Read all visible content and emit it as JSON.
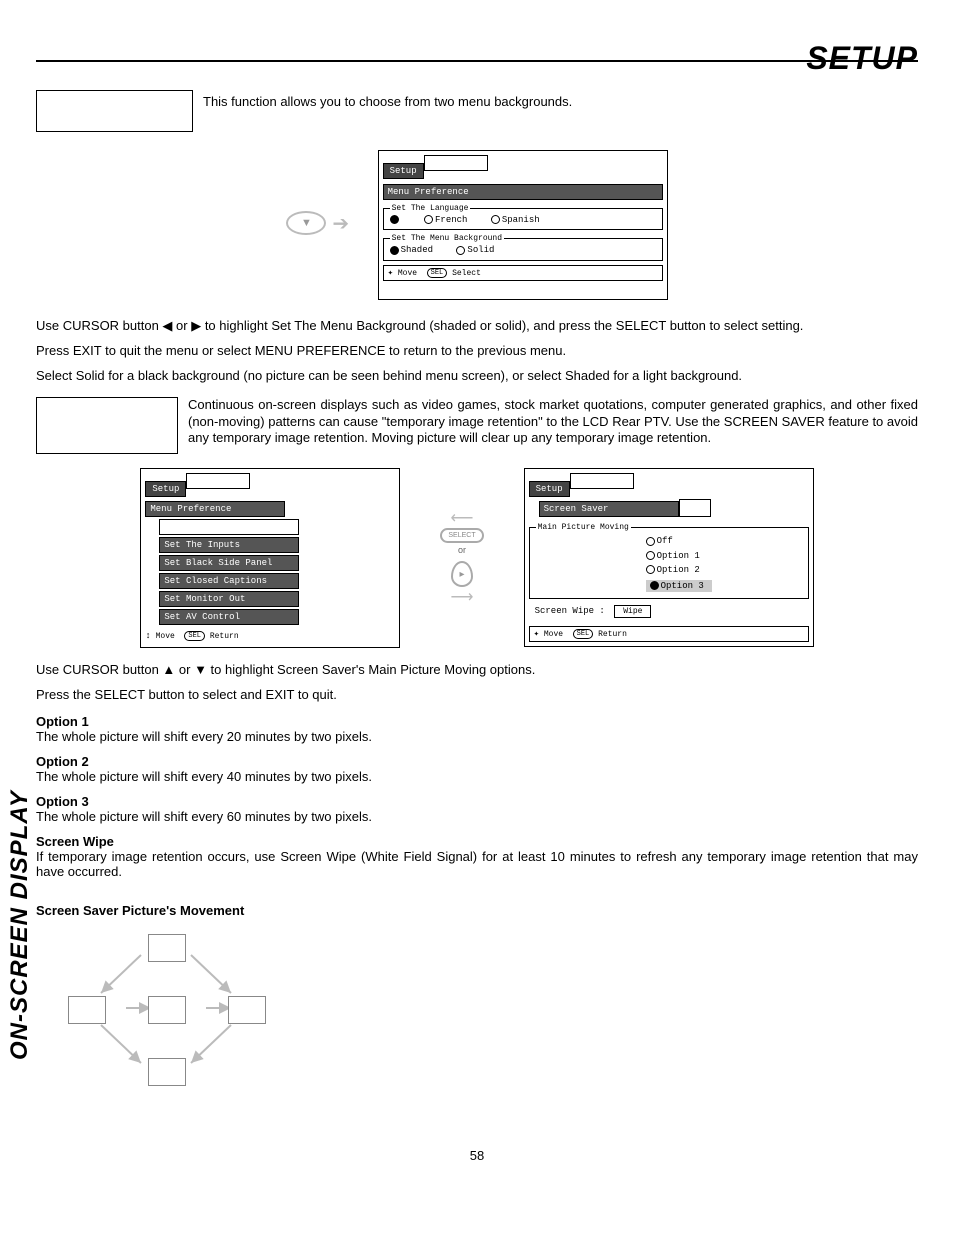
{
  "header": {
    "title": "SETUP"
  },
  "sideLabel": "ON-SCREEN DISPLAY",
  "section1": {
    "intro": "This function allows you to choose from two menu backgrounds.",
    "osd1": {
      "tab": "Setup",
      "subtitle": "Menu Preference",
      "langLegend": "Set The Language",
      "langOpts": {
        "french": "French",
        "spanish": "Spanish"
      },
      "bgLegend": "Set The Menu Background",
      "bgOpts": {
        "shaded": "Shaded",
        "solid": "Solid"
      },
      "hintMove": "Move",
      "hintSel": "SEL",
      "hintSelect": "Select"
    },
    "para1": "Use CURSOR button ◀ or ▶ to highlight Set The Menu Background (shaded or solid), and press the SELECT button to select setting.",
    "para2": "Press EXIT to quit the menu or select MENU PREFERENCE to return to the previous menu.",
    "para3": "Select Solid for a black background (no picture can be seen behind menu screen), or select Shaded for a light background."
  },
  "section2": {
    "intro": "Continuous on-screen displays such as video games, stock market quotations, computer generated graphics, and other fixed (non-moving) patterns can cause \"temporary image retention\" to the LCD Rear PTV.  Use the SCREEN SAVER feature to avoid any temporary image retention.  Moving picture will clear up any temporary image retention.",
    "osdLeft": {
      "tab": "Setup",
      "items": [
        "Menu Preference",
        "Set The Inputs",
        "Set Black Side Panel",
        "Set Closed Captions",
        "Set Monitor Out",
        "Set AV Control"
      ],
      "hintMove": "Move",
      "hintSel": "SEL",
      "hintReturn": "Return"
    },
    "mid": {
      "select": "SELECT",
      "or": "or"
    },
    "osdRight": {
      "tab": "Setup",
      "sub": "Screen Saver",
      "legend": "Main Picture Moving",
      "opts": {
        "off": "Off",
        "o1": "Option 1",
        "o2": "Option 2",
        "o3": "Option 3"
      },
      "wipeLabel": "Screen Wipe :",
      "wipeBtn": "Wipe",
      "hintMove": "Move",
      "hintSel": "SEL",
      "hintReturn": "Return"
    },
    "para4": "Use CURSOR button ▲ or ▼ to highlight Screen Saver's Main Picture Moving options.",
    "para5": "Press the SELECT button to select and EXIT to quit.",
    "opt1h": "Option 1",
    "opt1b": "The whole picture will shift every 20 minutes by two pixels.",
    "opt2h": "Option 2",
    "opt2b": "The whole picture will shift every 40 minutes by two pixels.",
    "opt3h": "Option 3",
    "opt3b": "The whole picture will shift every 60 minutes by two pixels.",
    "wipeh": "Screen Wipe",
    "wipeb": "If temporary image retention occurs, use Screen Wipe (White Field Signal) for at least 10 minutes to refresh any temporary image retention that may have occurred.",
    "diagh": "Screen Saver Picture's Movement"
  },
  "pageNum": "58"
}
